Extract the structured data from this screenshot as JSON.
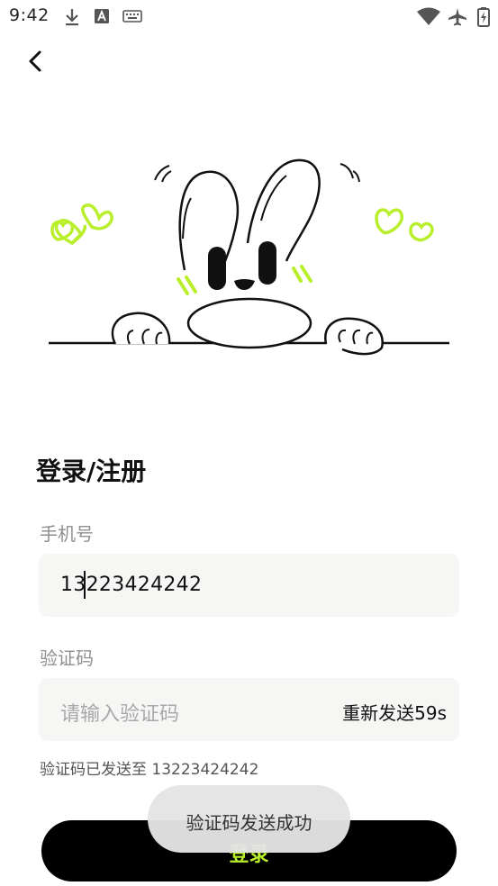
{
  "status_bar": {
    "time": "9:42",
    "icons": [
      "download-icon",
      "a-square-icon",
      "keyboard-icon",
      "wifi-icon",
      "airplane-icon",
      "battery-charging-icon"
    ]
  },
  "title": "登录/注册",
  "phone": {
    "label": "手机号",
    "value": "13223424242"
  },
  "code": {
    "label": "验证码",
    "placeholder": "请输入验证码",
    "resend_label": "重新发送59s"
  },
  "sent_hint": "验证码已发送至 13223424242",
  "login_button": "登录",
  "toast": "验证码发送成功",
  "colors": {
    "accent": "#b8ef2a",
    "button_bg": "#000000",
    "input_bg": "#f6f6f4"
  }
}
